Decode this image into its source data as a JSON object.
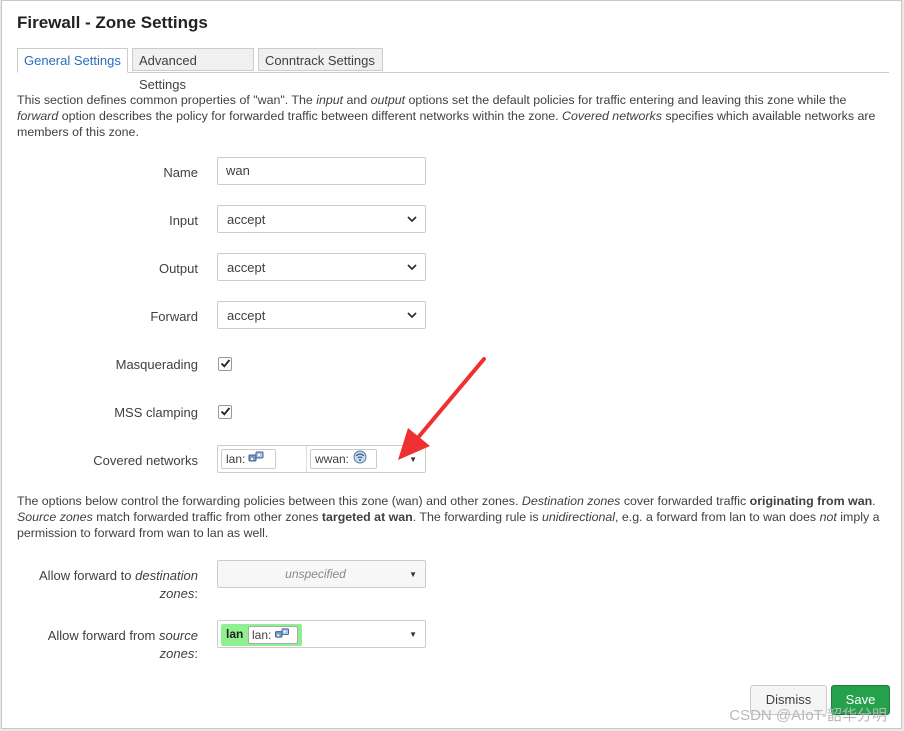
{
  "dialog": {
    "title": "Firewall - Zone Settings"
  },
  "tabs": [
    {
      "label": "General Settings",
      "active": true
    },
    {
      "label": "Advanced Settings",
      "active": false
    },
    {
      "label": "Conntrack Settings",
      "active": false
    }
  ],
  "intro": {
    "t1": "This section defines common properties of \"wan\". The ",
    "em_input": "input",
    "t2": " and ",
    "em_output": "output",
    "t3": " options set the default policies for traffic entering and leaving this zone while the ",
    "em_forward": "forward",
    "t4": " option describes the policy for forwarded traffic between different networks within the zone. ",
    "em_covered": "Covered networks",
    "t5": " specifies which available networks are members of this zone."
  },
  "fields": {
    "name": {
      "label": "Name",
      "value": "wan"
    },
    "input": {
      "label": "Input",
      "value": "accept"
    },
    "output": {
      "label": "Output",
      "value": "accept"
    },
    "forward": {
      "label": "Forward",
      "value": "accept"
    },
    "masquerading": {
      "label": "Masquerading",
      "checked": true
    },
    "mss_clamping": {
      "label": "MSS clamping",
      "checked": true
    },
    "covered_networks": {
      "label": "Covered networks",
      "items": [
        {
          "label": "lan:",
          "icon": "ethernet-icon"
        },
        {
          "label": "wwan:",
          "icon": "wireless-icon"
        }
      ]
    }
  },
  "forwarding": {
    "t1": "The options below control the forwarding policies between this zone (wan) and other zones. ",
    "em_dest": "Destination zones",
    "t2": " cover forwarded traffic ",
    "b_orig": "originating from wan",
    "t3": ". ",
    "em_source": "Source zones",
    "t4": " match forwarded traffic from other zones ",
    "b_target": "targeted at wan",
    "t5": ". The forwarding rule is ",
    "em_uni": "unidirectional",
    "t6": ", e.g. a forward from lan to wan does ",
    "em_not": "not",
    "t7": " imply a permission to forward from wan to lan as well."
  },
  "allow_dest": {
    "label_a": "Allow forward to ",
    "label_em": "destination",
    "label_b": "zones",
    "label_colon": ":",
    "value": "unspecified"
  },
  "allow_src": {
    "label_a": "Allow forward from ",
    "label_em": "source",
    "label_b": "zones",
    "label_colon": ":",
    "zone": "lan",
    "zone_net": "lan:"
  },
  "buttons": {
    "dismiss": "Dismiss",
    "save": "Save"
  },
  "watermark": "CSDN @AIoT-韶华分明",
  "colors": {
    "accent": "#2a6ebb",
    "save": "#25a14c",
    "zone_lan": "#90f090",
    "arrow": "#f03030"
  }
}
